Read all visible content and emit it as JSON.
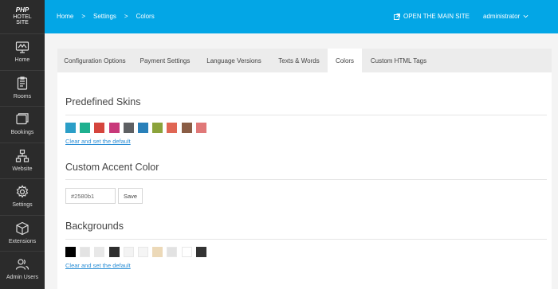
{
  "logo": {
    "line1": "PHP",
    "line2": "HOTEL",
    "line3": "SITE"
  },
  "sidebar": {
    "items": [
      {
        "label": "Home",
        "icon": "home-icon"
      },
      {
        "label": "Rooms",
        "icon": "rooms-icon"
      },
      {
        "label": "Bookings",
        "icon": "bookings-icon"
      },
      {
        "label": "Website",
        "icon": "sitemap-icon"
      },
      {
        "label": "Settings",
        "icon": "gear-icon"
      },
      {
        "label": "Extensions",
        "icon": "cube-icon"
      },
      {
        "label": "Admin Users",
        "icon": "users-icon"
      }
    ]
  },
  "header": {
    "breadcrumb": [
      "Home",
      ">",
      "Settings",
      ">",
      "Colors"
    ],
    "open_site_label": "OPEN THE MAIN SITE",
    "user_label": "administrator"
  },
  "tabs": [
    {
      "label": "Configuration Options",
      "active": false
    },
    {
      "label": "Payment Settings",
      "active": false
    },
    {
      "label": "Language Versions",
      "active": false
    },
    {
      "label": "Texts & Words",
      "active": false
    },
    {
      "label": "Colors",
      "active": true
    },
    {
      "label": "Custom HTML Tags",
      "active": false
    }
  ],
  "predefined_skins": {
    "title": "Predefined Skins",
    "colors": [
      "#2b9ec7",
      "#1fb08f",
      "#d5453d",
      "#c8397a",
      "#5e6063",
      "#2980b9",
      "#8ba33b",
      "#e06654",
      "#8a5d45",
      "#e07878"
    ],
    "reset_link": "Clear and set the default"
  },
  "custom_accent": {
    "title": "Custom Accent Color",
    "value": "#2580b1",
    "save_label": "Save"
  },
  "backgrounds": {
    "title": "Backgrounds",
    "colors": [
      "#000000",
      "#e3e3e3",
      "#e8e8e8",
      "#2e2e2e",
      "#f3f3f3",
      "#f5f5f5",
      "#ecd9b8",
      "#e2e2e2",
      "#ffffff",
      "#333333"
    ],
    "reset_link": "Clear and set the default"
  },
  "colors": {
    "sidebar_bg": "#2b2b2b",
    "topbar_bg": "#03a6e6",
    "link": "#2c8fd6"
  }
}
